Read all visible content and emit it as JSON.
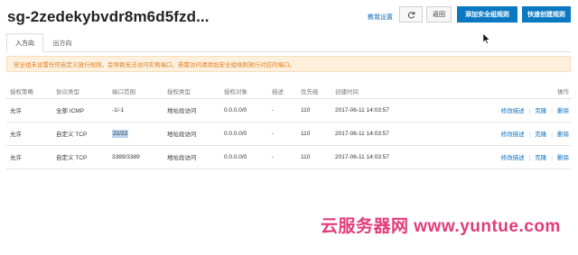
{
  "header": {
    "title": "sg-2zedekybvdr8m6d5fzd...",
    "guide_link": "教我设置",
    "refresh_icon": "refresh-icon",
    "back_label": "返回",
    "add_rule_label": "添加安全组规则",
    "quick_rule_label": "快速创建规则"
  },
  "tabs": [
    {
      "label": "入方向",
      "active": true
    },
    {
      "label": "出方向",
      "active": false
    }
  ],
  "notice": "安全组未设置任何自定义放行规则，会导致无法访问实例端口，若需访问请添加安全组规则放行对应的端口。",
  "table": {
    "columns": [
      "授权策略",
      "协议类型",
      "端口范围",
      "授权类型",
      "授权对象",
      "描述",
      "优先级",
      "创建时间",
      "操作"
    ],
    "rows": [
      {
        "policy": "允许",
        "protocol": "全部 ICMP",
        "port": "-1/-1",
        "auth_type": "地址段访问",
        "object": "0.0.0.0/0",
        "desc": "-",
        "priority": "110",
        "time": "2017-06-11 14:03:57",
        "op_edit": "修改描述",
        "op_clone": "克隆",
        "op_delete": "删除"
      },
      {
        "policy": "允许",
        "protocol": "自定义 TCP",
        "port": "22/22",
        "auth_type": "地址段访问",
        "object": "0.0.0.0/0",
        "desc": "-",
        "priority": "110",
        "time": "2017-06-11 14:03:57",
        "op_edit": "修改描述",
        "op_clone": "克隆",
        "op_delete": "删除"
      },
      {
        "policy": "允许",
        "protocol": "自定义 TCP",
        "port": "3389/3389",
        "auth_type": "地址段访问",
        "object": "0.0.0.0/0",
        "desc": "-",
        "priority": "110",
        "time": "2017-06-11 14:03:57",
        "op_edit": "修改描述",
        "op_clone": "克隆",
        "op_delete": "删除"
      }
    ]
  },
  "watermark": "云服务器网 www.yuntue.com",
  "colors": {
    "accent": "#0a79c1",
    "link": "#0b6fbf",
    "notice_bg": "#fdf1de",
    "notice_text": "#e07a1b",
    "watermark": "#e23c7a"
  }
}
